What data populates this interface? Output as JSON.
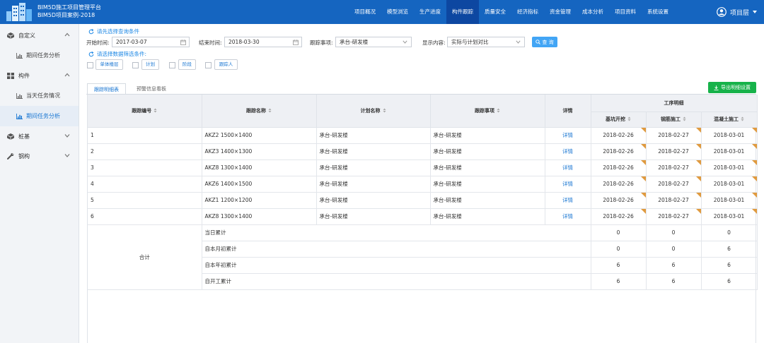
{
  "header": {
    "brand_line1": "BIM5D施工项目管理平台",
    "brand_line2": "BIM5D项目案例-2018",
    "nav": [
      {
        "label": "项目概况",
        "active": false
      },
      {
        "label": "模型浏览",
        "active": false
      },
      {
        "label": "生产进度",
        "active": false
      },
      {
        "label": "构件跟踪",
        "active": true
      },
      {
        "label": "质量安全",
        "active": false
      },
      {
        "label": "经济指标",
        "active": false
      },
      {
        "label": "资金管理",
        "active": false
      },
      {
        "label": "成本分析",
        "active": false
      },
      {
        "label": "项目资料",
        "active": false
      },
      {
        "label": "系统设置",
        "active": false
      }
    ],
    "user_label": "项目层"
  },
  "sidebar": {
    "groups": [
      {
        "label": "自定义",
        "expanded": true,
        "icon": "cube-icon",
        "items": [
          {
            "label": "期间任务分析",
            "active": false
          }
        ]
      },
      {
        "label": "构件",
        "expanded": true,
        "icon": "grid-icon",
        "items": [
          {
            "label": "当天任务情况",
            "active": false
          },
          {
            "label": "期间任务分析",
            "active": true
          }
        ]
      },
      {
        "label": "桩基",
        "expanded": false,
        "icon": "cube-icon",
        "items": []
      },
      {
        "label": "钢构",
        "expanded": false,
        "icon": "wrench-icon",
        "items": []
      }
    ]
  },
  "filters": {
    "hint_query": "请先选择查询条件",
    "start_label": "开始时间:",
    "start_value": "2017-03-07",
    "end_label": "结束时间:",
    "end_value": "2018-03-30",
    "track_label": "跟踪事项:",
    "track_value": "承台-研发楼",
    "display_label": "显示内容:",
    "display_value": "实际与计划对比",
    "query_button": "查 询",
    "hint_filter": "请选择数据筛选条件:",
    "chips": [
      "单体楼层",
      "计划",
      "阶段",
      "跟踪人"
    ]
  },
  "tabs": [
    {
      "label": "跟踪明细表",
      "active": true
    },
    {
      "label": "预警信息看板",
      "active": false
    }
  ],
  "export_button": "导出明细设置",
  "table": {
    "headers": {
      "code": "跟踪编号",
      "name": "跟踪名称",
      "plan": "计划名称",
      "item": "跟踪事项",
      "detail": "详情",
      "group": "工序明细",
      "steps": [
        "基坑开挖",
        "钢筋施工",
        "混凝土施工"
      ]
    },
    "rows": [
      {
        "code": "1",
        "name": "AKZ2 1500×1400",
        "plan": "承台-研发楼",
        "item": "承台-研发楼",
        "detail": "详情",
        "steps": [
          "2018-02-26",
          "2018-02-27",
          "2018-03-01"
        ]
      },
      {
        "code": "2",
        "name": "AKZ3 1400×1300",
        "plan": "承台-研发楼",
        "item": "承台-研发楼",
        "detail": "详情",
        "steps": [
          "2018-02-26",
          "2018-02-27",
          "2018-03-01"
        ]
      },
      {
        "code": "3",
        "name": "AKZ8 1300×1400",
        "plan": "承台-研发楼",
        "item": "承台-研发楼",
        "detail": "详情",
        "steps": [
          "2018-02-26",
          "2018-02-27",
          "2018-03-01"
        ]
      },
      {
        "code": "4",
        "name": "AKZ6 1400×1500",
        "plan": "承台-研发楼",
        "item": "承台-研发楼",
        "detail": "详情",
        "steps": [
          "2018-02-26",
          "2018-02-27",
          "2018-03-01"
        ]
      },
      {
        "code": "5",
        "name": "AKZ1 1200×1200",
        "plan": "承台-研发楼",
        "item": "承台-研发楼",
        "detail": "详情",
        "steps": [
          "2018-02-26",
          "2018-02-27",
          "2018-03-01"
        ]
      },
      {
        "code": "6",
        "name": "AKZ8 1300×1400",
        "plan": "承台-研发楼",
        "item": "承台-研发楼",
        "detail": "详情",
        "steps": [
          "2018-02-26",
          "2018-02-27",
          "2018-03-01"
        ]
      }
    ],
    "summary_label": "合计",
    "summary": [
      {
        "label": "当日累计",
        "values": [
          "0",
          "0",
          "0"
        ]
      },
      {
        "label": "自本月初累计",
        "values": [
          "0",
          "0",
          "6"
        ]
      },
      {
        "label": "自本年初累计",
        "values": [
          "6",
          "6",
          "6"
        ]
      },
      {
        "label": "自开工累计",
        "values": [
          "6",
          "6",
          "6"
        ]
      }
    ]
  },
  "colors": {
    "header_bg": "#1565c0",
    "nav_active_bg": "#0d47a1",
    "accent": "#1976d2",
    "export_green": "#17b24a",
    "warning_corner": "#e09a3e"
  }
}
